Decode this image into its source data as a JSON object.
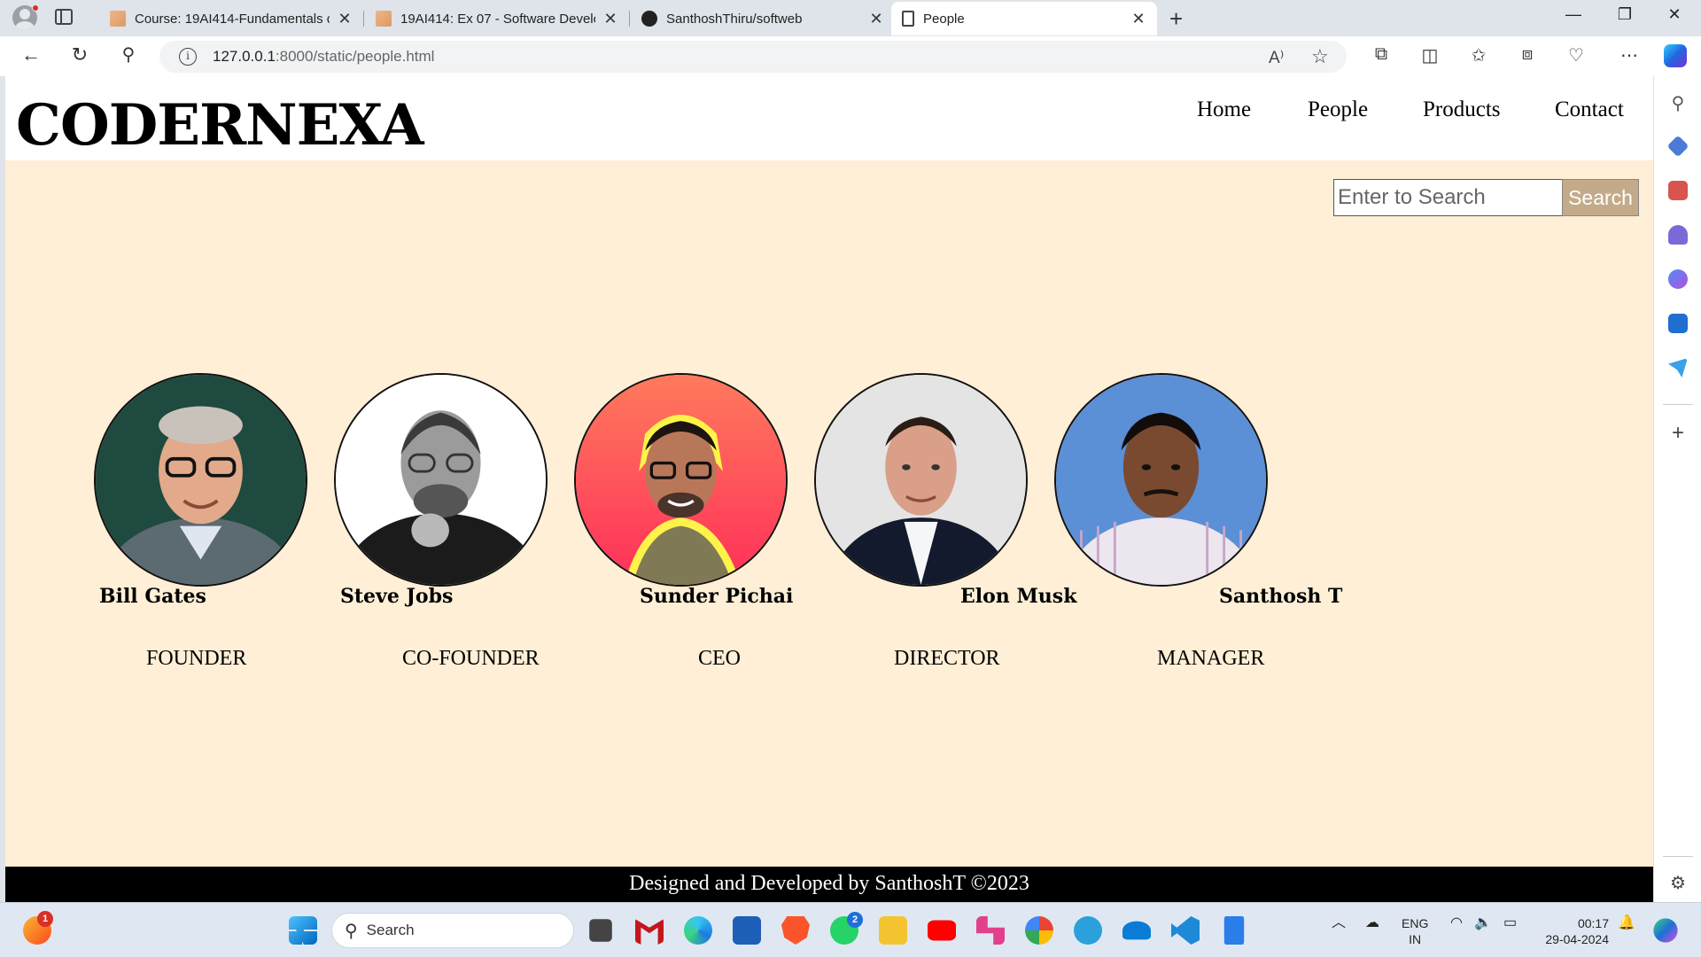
{
  "browser": {
    "tabs": [
      {
        "title": "Course: 19AI414-Fundamentals of",
        "favicon": "moodle-icon",
        "active": false
      },
      {
        "title": "19AI414: Ex 07 - Software Develo",
        "favicon": "moodle-icon",
        "active": false
      },
      {
        "title": "SanthoshThiru/softweb",
        "favicon": "github-icon",
        "active": false
      },
      {
        "title": "People",
        "favicon": "page-icon",
        "active": true
      }
    ],
    "url_host": "127.0.0.1",
    "url_path": ":8000/static/people.html"
  },
  "site": {
    "brand": "CODERNEXA",
    "nav": [
      "Home",
      "People",
      "Products",
      "Contact"
    ],
    "search": {
      "placeholder": "Enter to Search",
      "button": "Search"
    },
    "people": [
      {
        "name": "Bill Gates",
        "role": "FOUNDER",
        "bg": "#1f4a3f"
      },
      {
        "name": "Steve Jobs",
        "role": "CO-FOUNDER",
        "bg": "#ffffff"
      },
      {
        "name": "Sunder Pichai",
        "role": "CEO",
        "bg": "#ff4d4d"
      },
      {
        "name": "Elon Musk",
        "role": "DIRECTOR",
        "bg": "#e4e4e4"
      },
      {
        "name": "Santhosh T",
        "role": "MANAGER",
        "bg": "#5b8fd6"
      }
    ],
    "footer": "Designed and Developed by SanthoshT ©2023"
  },
  "taskbar": {
    "search_placeholder": "Search",
    "language": "ENG",
    "region": "IN",
    "time": "00:17",
    "date": "29-04-2024",
    "whatsapp_badge": "2",
    "notification_badge": "1"
  },
  "colors": {
    "page_bg": "#feefd6",
    "search_button": "#c3ab8a",
    "footer_bg": "#000000"
  }
}
